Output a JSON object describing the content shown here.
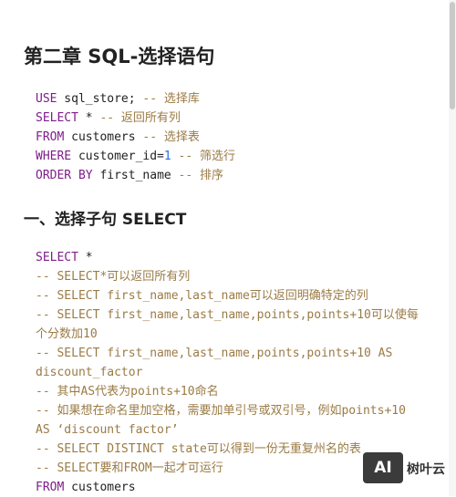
{
  "chapter_title": "第二章 SQL-选择语句",
  "section_title": "一、选择子句 SELECT",
  "code_block_1": [
    {
      "kw": "USE",
      "rest": " sql_store;",
      "comment": " -- 选择库"
    },
    {
      "kw": "SELECT",
      "rest": " *",
      "comment": " -- 返回所有列"
    },
    {
      "kw": "FROM",
      "rest": " customers",
      "comment": " -- 选择表"
    },
    {
      "kw": "WHERE",
      "rest": " customer_id=",
      "num": "1",
      "comment": " -- 筛选行"
    },
    {
      "kw": "ORDER BY",
      "rest": " first_name",
      "comment": " -- 排序"
    }
  ],
  "code_block_2": {
    "l1_kw": "SELECT",
    "l1_rest": " *",
    "l2": "-- SELECT*可以返回所有列",
    "l3": "-- SELECT first_name,last_name可以返回明确特定的列",
    "l4": "-- SELECT first_name,last_name,points,points+10可以使每个分数加10",
    "l5": "-- SELECT first_name,last_name,points,points+10 AS discount_factor",
    "l6": "-- 其中AS代表为points+10命名",
    "l7": "-- 如果想在命名里加空格，需要加单引号或双引号，例如points+10 AS ‘discount factor’",
    "l8": "-- SELECT DISTINCT state可以得到一份无重复州名的表",
    "l9": "-- SELECT要和FROM一起才可运行",
    "l10_kw": "FROM",
    "l10_rest": " customers"
  },
  "watermark": {
    "logo": "AI",
    "text": "树叶云"
  }
}
